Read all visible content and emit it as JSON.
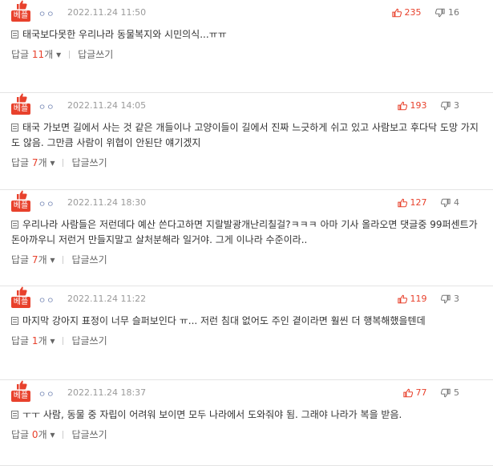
{
  "best_label": "베플",
  "comments": [
    {
      "user": "ㅇㅇ",
      "date": "2022.11.24 11:50",
      "up": "235",
      "down": "16",
      "text": "태국보다못한 우리나라 동물복지와 시민의식...ㅠㅠ",
      "reply_label": "답글",
      "reply_count": "11",
      "reply_unit": "개",
      "reply_arrow": "▾",
      "write_label": "답글쓰기"
    },
    {
      "user": "ㅇㅇ",
      "date": "2022.11.24 14:05",
      "up": "193",
      "down": "3",
      "text": "태국 가보면 길에서 사는 것 같은 개들이나 고양이들이 길에서 진짜 느긋하게 쉬고 있고 사람보고 후다닥 도망 가지도 않음. 그만큼 사람이 위협이 안된단 얘기겠지",
      "reply_label": "답글",
      "reply_count": "7",
      "reply_unit": "개",
      "reply_arrow": "▾",
      "write_label": "답글쓰기"
    },
    {
      "user": "ㅇㅇ",
      "date": "2022.11.24 18:30",
      "up": "127",
      "down": "4",
      "text": "우리나라 사람들은 저런데다 예산 쓴다고하면 지랄발광개난리칠걸?ㅋㅋㅋ 아마 기사 올라오면 댓글중 99퍼센트가 돈아까우니 저런거 만들지말고 살처분해라 일거야. 그게 이나라 수준이라..",
      "reply_label": "답글",
      "reply_count": "7",
      "reply_unit": "개",
      "reply_arrow": "▾",
      "write_label": "답글쓰기"
    },
    {
      "user": "ㅇㅇ",
      "date": "2022.11.24 11:22",
      "up": "119",
      "down": "3",
      "text": "마지막 강아지 표정이 너무 슬퍼보인다 ㅠ... 저런 침대 없어도 주인 곁이라면 훨씬 더 행복해했을텐데",
      "reply_label": "답글",
      "reply_count": "1",
      "reply_unit": "개",
      "reply_arrow": "▾",
      "write_label": "답글쓰기"
    },
    {
      "user": "ㅇㅇ",
      "date": "2022.11.24 18:37",
      "up": "77",
      "down": "5",
      "text": "ㅜㅜ 사람, 동물 중 자립이 어려워 보이면 모두 나라에서 도와줘야 됨. 그래야 나라가 복을 받음.",
      "reply_label": "답글",
      "reply_count": "0",
      "reply_unit": "개",
      "reply_arrow": "▾",
      "write_label": "답글쓰기"
    }
  ],
  "colors": {
    "accent": "#e8412c",
    "user": "#7b8cb8",
    "meta": "#9a9a9a",
    "divider": "#e4e4e4"
  }
}
